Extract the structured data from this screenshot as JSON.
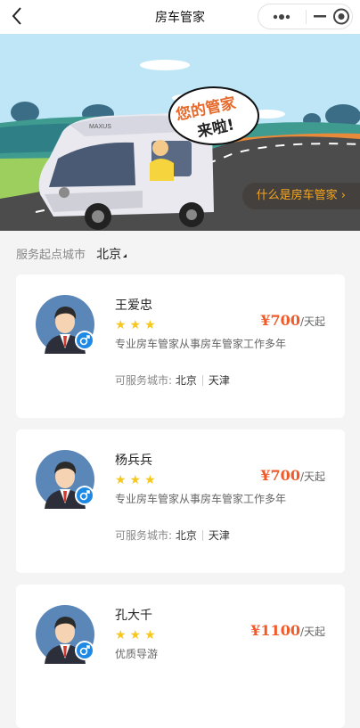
{
  "nav": {
    "title": "房车管家",
    "back_icon": "chevron-left-icon",
    "more_icon": "ellipsis-icon",
    "minimize_icon": "minus-icon",
    "close_icon": "target-icon"
  },
  "banner": {
    "bubble_text_line1": "您的管家",
    "bubble_text_line2": "来啦!",
    "vehicle_brand": "MAXUS",
    "whatis_label": "什么是房车管家",
    "whatis_arrow": "›"
  },
  "city": {
    "label": "服务起点城市",
    "value": "北京"
  },
  "stewards": [
    {
      "name": "王爱忠",
      "stars": "★★★",
      "price_symbol": "¥",
      "price": "700",
      "unit": "/天起",
      "desc": "专业房车管家从事房车管家工作多年",
      "cities_label": "可服务城市:",
      "cities": [
        "北京",
        "天津"
      ]
    },
    {
      "name": "杨兵兵",
      "stars": "★★★",
      "price_symbol": "¥",
      "price": "700",
      "unit": "/天起",
      "desc": "专业房车管家从事房车管家工作多年",
      "cities_label": "可服务城市:",
      "cities": [
        "北京",
        "天津"
      ]
    },
    {
      "name": "孔大千",
      "stars": "★★★",
      "price_symbol": "¥",
      "price": "1100",
      "unit": "/天起",
      "desc": "优质导游"
    }
  ],
  "colors": {
    "accent": "#f05a28",
    "star": "#f7c81b",
    "gender": "#1e88e5",
    "whatis_text": "#f5a623"
  }
}
